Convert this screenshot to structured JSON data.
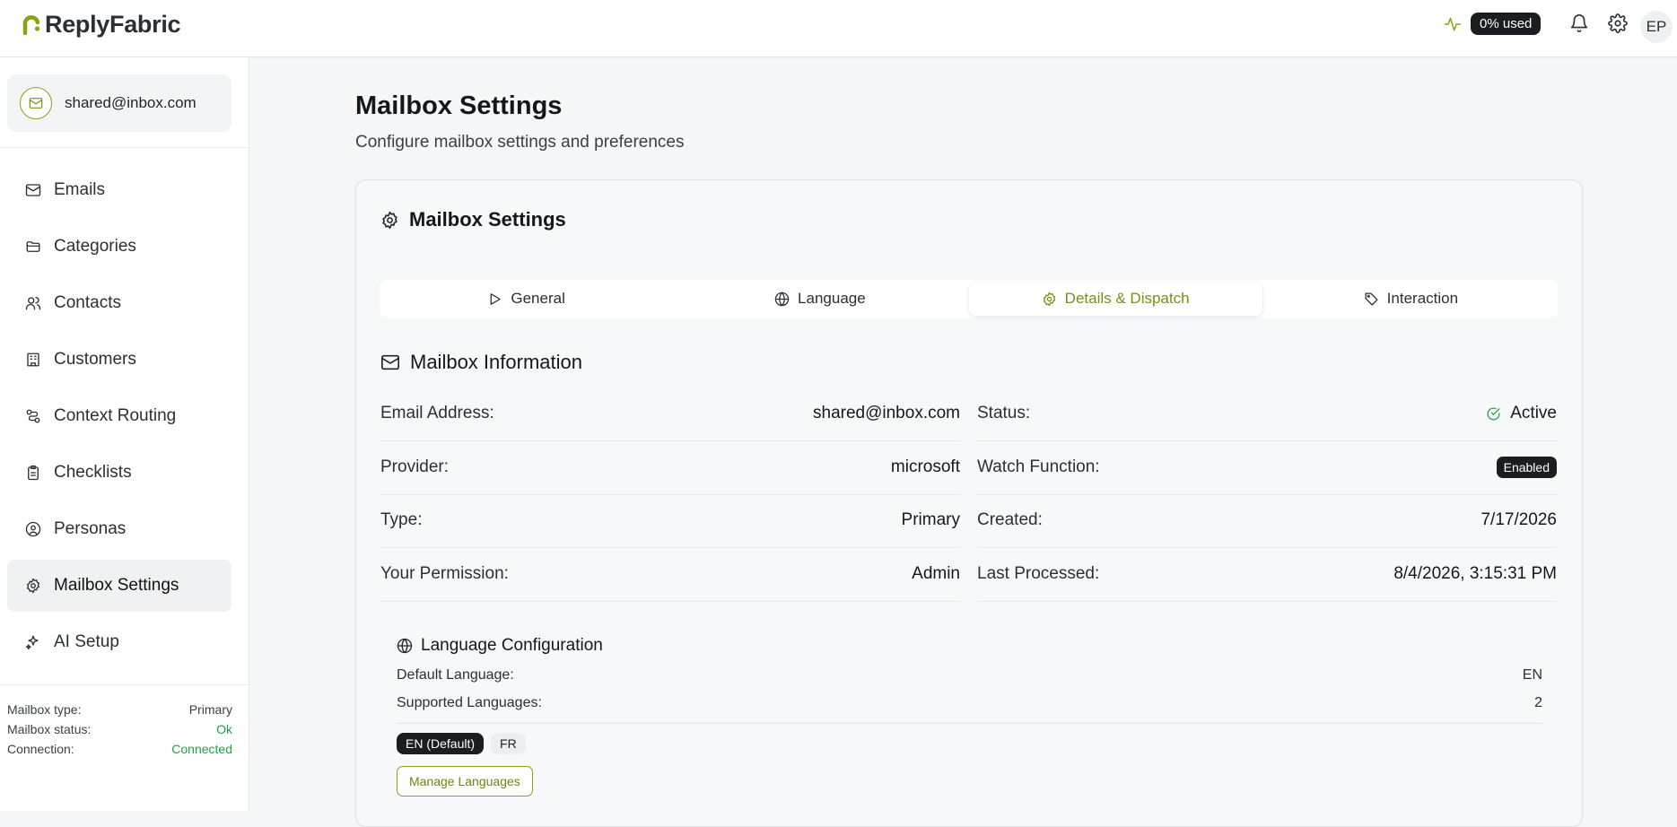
{
  "brand": {
    "name": "ReplyFabric",
    "accent": "#8aa019"
  },
  "topbar": {
    "usage_label": "0% used",
    "avatar_initials": "EP"
  },
  "sidebar": {
    "mailbox_email": "shared@inbox.com",
    "items": [
      {
        "label": "Emails",
        "icon": "mail-icon"
      },
      {
        "label": "Categories",
        "icon": "folder-icon"
      },
      {
        "label": "Contacts",
        "icon": "users-icon"
      },
      {
        "label": "Customers",
        "icon": "building-icon"
      },
      {
        "label": "Context Routing",
        "icon": "route-icon"
      },
      {
        "label": "Checklists",
        "icon": "clipboard-icon"
      },
      {
        "label": "Personas",
        "icon": "user-circle-icon"
      },
      {
        "label": "Mailbox Settings",
        "icon": "gear-icon",
        "active": true
      },
      {
        "label": "AI Setup",
        "icon": "sparkles-icon"
      }
    ],
    "meta": {
      "type_label": "Mailbox type:",
      "type_value": "Primary",
      "status_label": "Mailbox status:",
      "status_value": "Ok",
      "connection_label": "Connection:",
      "connection_value": "Connected"
    }
  },
  "page": {
    "title": "Mailbox Settings",
    "subtitle": "Configure mailbox settings and preferences"
  },
  "card": {
    "title": "Mailbox Settings",
    "tabs": [
      {
        "label": "General",
        "icon": "play-icon"
      },
      {
        "label": "Language",
        "icon": "globe-icon"
      },
      {
        "label": "Details & Dispatch",
        "icon": "gear-icon",
        "active": true
      },
      {
        "label": "Interaction",
        "icon": "tag-icon"
      }
    ],
    "info_title": "Mailbox Information",
    "info": {
      "email_label": "Email Address:",
      "email_value": "shared@inbox.com",
      "status_label": "Status:",
      "status_value": "Active",
      "provider_label": "Provider:",
      "provider_value": "microsoft",
      "watch_label": "Watch Function:",
      "watch_value": "Enabled",
      "type_label": "Type:",
      "type_value": "Primary",
      "created_label": "Created:",
      "created_value": "7/17/2026",
      "permission_label": "Your Permission:",
      "permission_value": "Admin",
      "processed_label": "Last Processed:",
      "processed_value": "8/4/2026, 3:15:31 PM"
    },
    "language": {
      "title": "Language Configuration",
      "default_label": "Default Language:",
      "default_value": "EN",
      "supported_label": "Supported Languages:",
      "supported_value": "2",
      "chips": [
        "EN (Default)",
        "FR"
      ],
      "manage_button": "Manage Languages"
    }
  }
}
